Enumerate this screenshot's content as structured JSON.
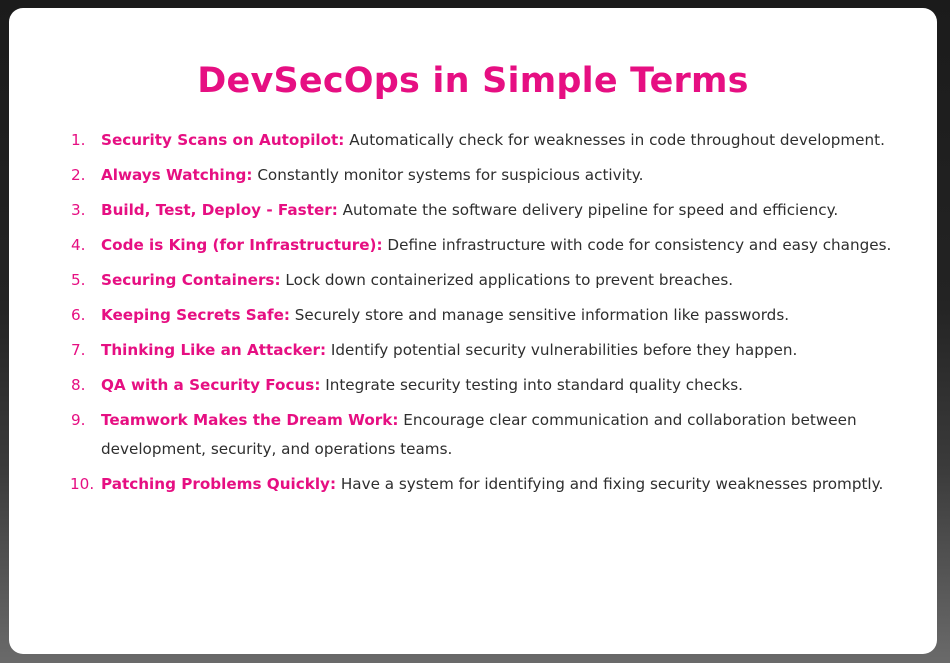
{
  "title": "DevSecOps in Simple Terms",
  "items": [
    {
      "num": "1.",
      "term": "Security Scans on Autopilot:",
      "desc": "Automatically check for weaknesses in code throughout development."
    },
    {
      "num": "2.",
      "term": "Always Watching:",
      "desc": "Constantly monitor systems for suspicious activity."
    },
    {
      "num": "3.",
      "term": "Build, Test, Deploy - Faster:",
      "desc": "Automate the software delivery pipeline for speed and efficiency."
    },
    {
      "num": "4.",
      "term": "Code is King (for Infrastructure):",
      "desc": "Define infrastructure with code for consistency and easy changes."
    },
    {
      "num": "5.",
      "term": "Securing Containers:",
      "desc": "Lock down containerized applications to prevent breaches."
    },
    {
      "num": "6.",
      "term": "Keeping Secrets Safe:",
      "desc": "Securely store and manage sensitive information like passwords."
    },
    {
      "num": "7.",
      "term": "Thinking Like an Attacker:",
      "desc": "Identify potential security vulnerabilities before they happen."
    },
    {
      "num": "8.",
      "term": "QA with a Security Focus:",
      "desc": "Integrate security testing into standard quality checks."
    },
    {
      "num": "9.",
      "term": "Teamwork Makes the Dream Work:",
      "desc": "Encourage clear communication and collaboration between development, security, and operations teams."
    },
    {
      "num": "10.",
      "term": "Patching Problems Quickly:",
      "desc": "Have a system for identifying and fixing security weaknesses promptly."
    }
  ],
  "colors": {
    "accent": "#e60f82",
    "text": "#2e2e2e",
    "card": "#ffffff"
  }
}
